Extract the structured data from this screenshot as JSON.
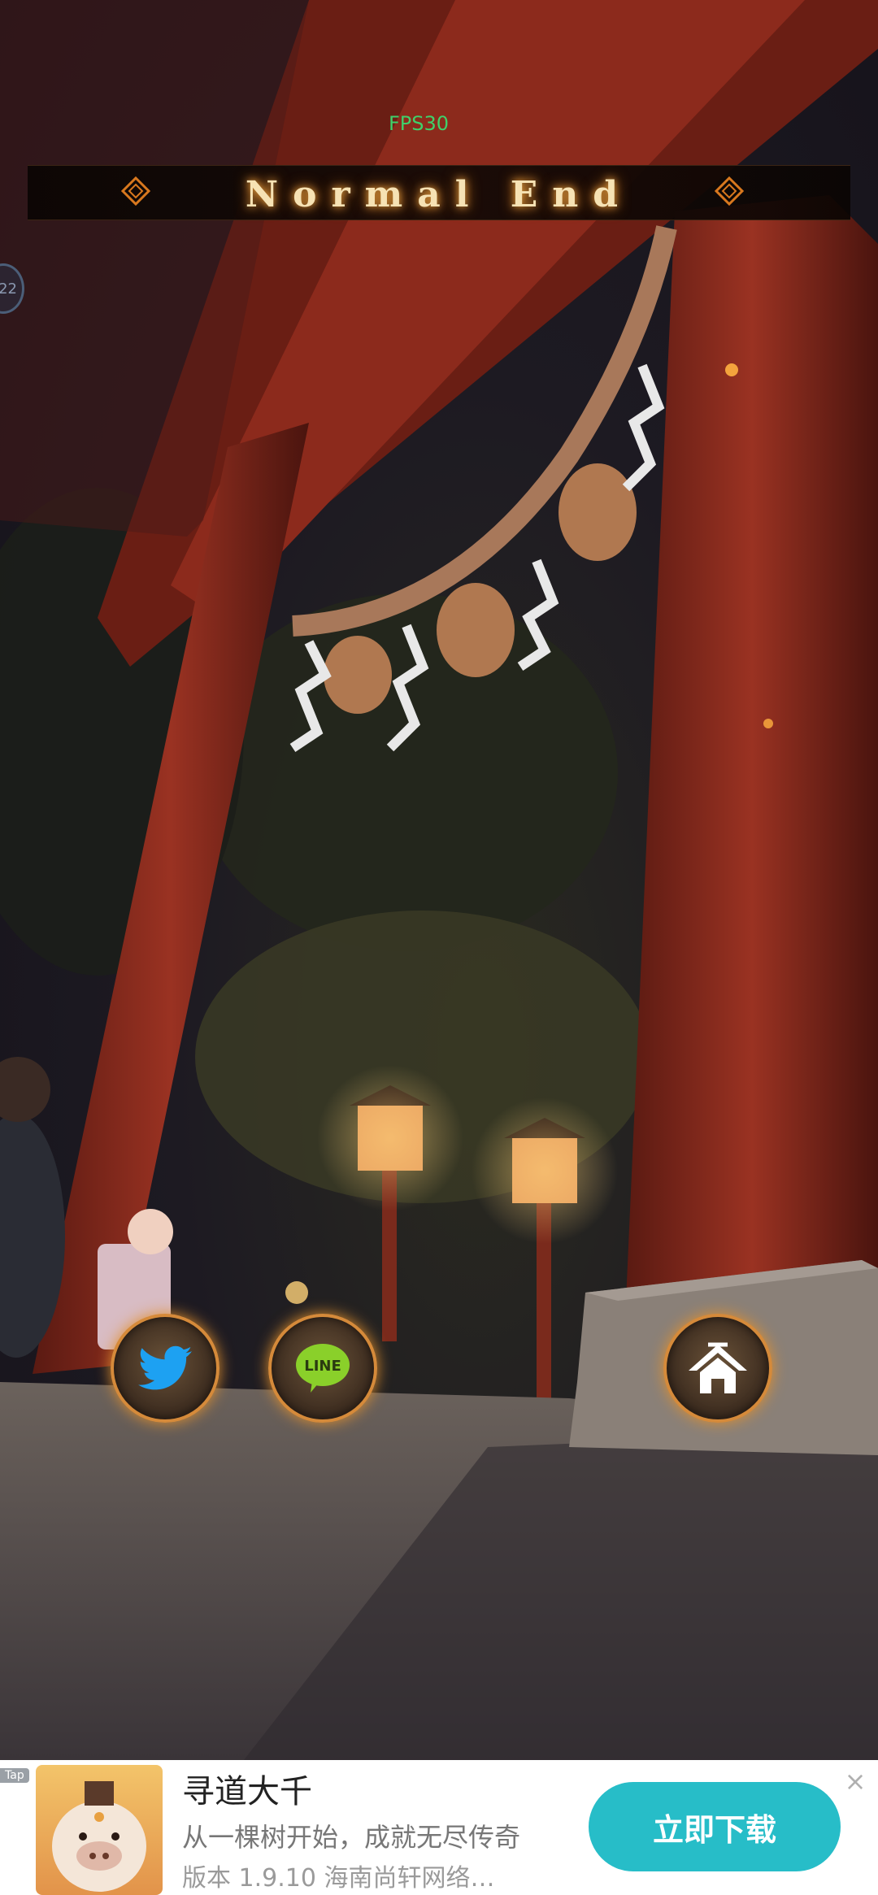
{
  "hud": {
    "fps": "FPS30",
    "side_badge": "22"
  },
  "banner": {
    "title": "Normal End"
  },
  "buttons": {
    "twitter": {
      "label": "twitter-icon"
    },
    "line": {
      "label": "LINE"
    },
    "home": {
      "label": "home-icon"
    }
  },
  "ad": {
    "tag": "Tap",
    "title": "寻道大千",
    "subtitle": "从一棵树开始，成就无尽传奇",
    "version": "版本 1.9.10  海南尚轩网络…",
    "cta": "立即下载",
    "close": "×"
  },
  "colors": {
    "accent": "#d58a3a",
    "cta": "#27bdc8",
    "torii": "#8c2a1c",
    "fps": "#3fd06a"
  }
}
